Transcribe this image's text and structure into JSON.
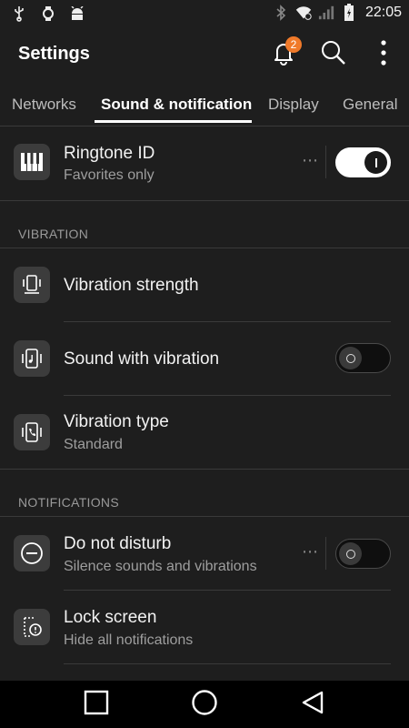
{
  "status_bar": {
    "time": "22:05",
    "left_icons": [
      "usb-icon",
      "watch-icon",
      "android-icon"
    ],
    "right_icons": [
      "bluetooth-icon",
      "wifi-icon",
      "signal-icon",
      "battery-icon"
    ]
  },
  "app_bar": {
    "title": "Settings",
    "notification_count": "2",
    "badge_color": "#f07a2a"
  },
  "tabs": [
    {
      "label": "Networks",
      "active": false
    },
    {
      "label": "Sound & notification",
      "active": true
    },
    {
      "label": "Display",
      "active": false
    },
    {
      "label": "General",
      "active": false
    }
  ],
  "items": {
    "ringtone": {
      "title": "Ringtone ID",
      "subtitle": "Favorites only",
      "icon": "piano-keys-icon",
      "toggle": "on"
    },
    "vibration_strength": {
      "title": "Vibration strength",
      "icon": "vibrate-phone-icon"
    },
    "sound_with_vibration": {
      "title": "Sound with vibration",
      "icon": "music-vibrate-icon",
      "toggle": "off"
    },
    "vibration_type": {
      "title": "Vibration type",
      "subtitle": "Standard",
      "icon": "phone-call-vibrate-icon"
    },
    "do_not_disturb": {
      "title": "Do not disturb",
      "subtitle": "Silence sounds and vibrations",
      "icon": "minus-circle-icon",
      "toggle": "off"
    },
    "lock_screen": {
      "title": "Lock screen",
      "subtitle": "Hide all notifications",
      "icon": "lock-screen-alert-icon"
    }
  },
  "sections": {
    "vibration": "VIBRATION",
    "notifications": "NOTIFICATIONS"
  },
  "more_dots": "⋯",
  "nav_bar": [
    "recents-square-icon",
    "home-circle-icon",
    "back-triangle-icon"
  ]
}
